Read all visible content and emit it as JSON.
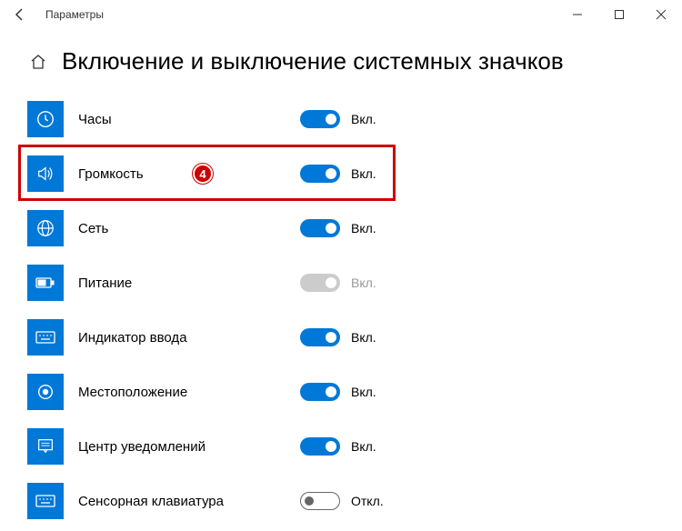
{
  "titlebar": {
    "app_name": "Параметры"
  },
  "page": {
    "title": "Включение и выключение системных значков"
  },
  "callout": {
    "number": "4"
  },
  "toggle_labels": {
    "on": "Вкл.",
    "off": "Откл."
  },
  "rows": [
    {
      "key": "clock",
      "label": "Часы",
      "state": "on"
    },
    {
      "key": "volume",
      "label": "Громкость",
      "state": "on",
      "highlighted": true
    },
    {
      "key": "network",
      "label": "Сеть",
      "state": "on"
    },
    {
      "key": "power",
      "label": "Питание",
      "state": "disabled"
    },
    {
      "key": "input",
      "label": "Индикатор ввода",
      "state": "on"
    },
    {
      "key": "location",
      "label": "Местоположение",
      "state": "on"
    },
    {
      "key": "action",
      "label": "Центр уведомлений",
      "state": "on"
    },
    {
      "key": "touchkb",
      "label": "Сенсорная клавиатура",
      "state": "off"
    }
  ]
}
